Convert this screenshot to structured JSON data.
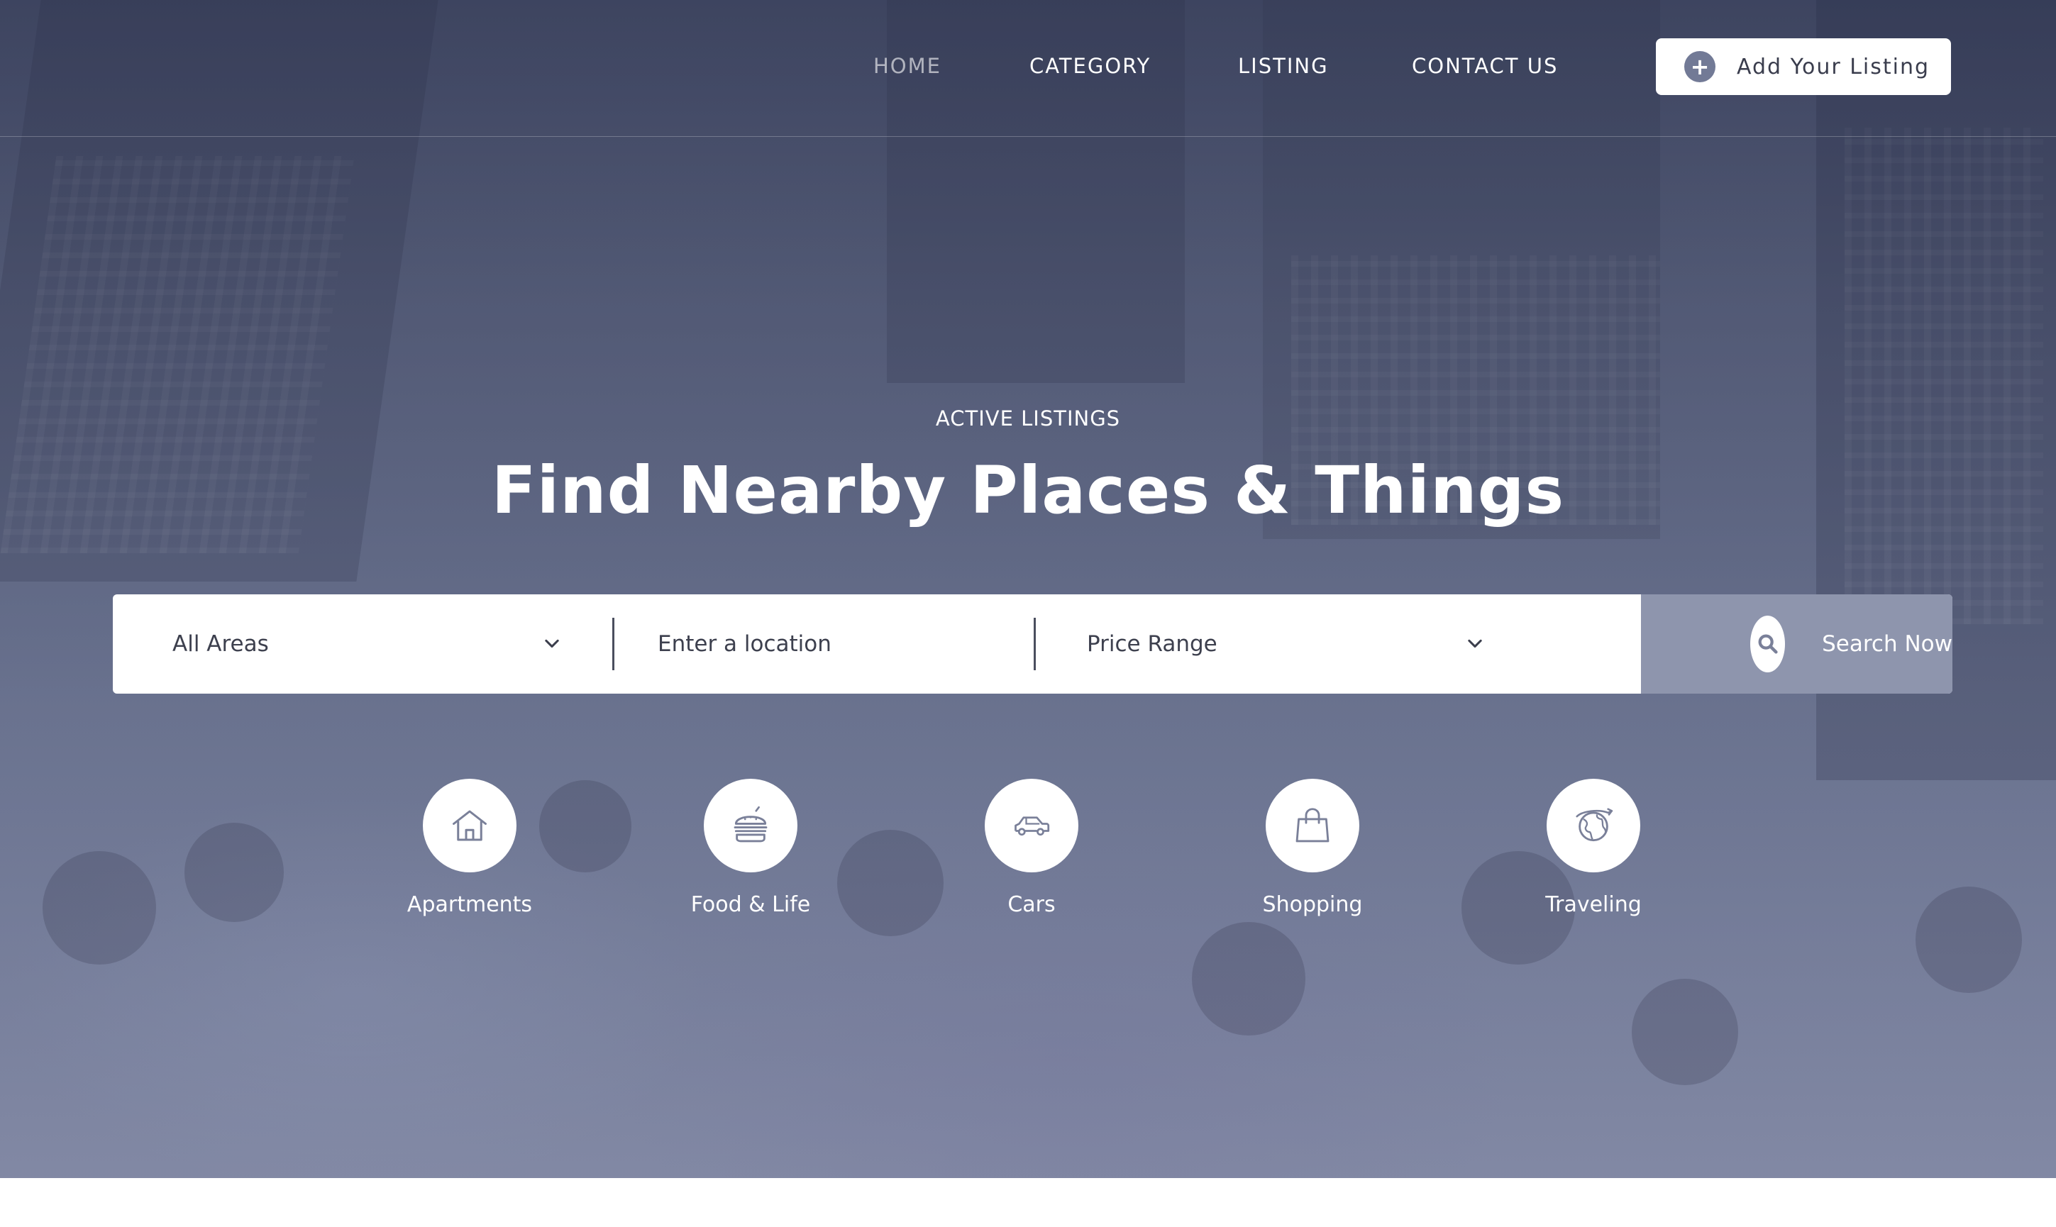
{
  "nav": {
    "links": [
      {
        "label": "HOME",
        "active": true
      },
      {
        "label": "CATEGORY",
        "active": false
      },
      {
        "label": "LISTING",
        "active": false
      },
      {
        "label": "CONTACT US",
        "active": false
      }
    ],
    "add_listing": {
      "icon": "plus-icon",
      "label": "Add Your Listing"
    }
  },
  "hero": {
    "eyebrow": "ACTIVE LISTINGS",
    "title": "Find Nearby Places & Things"
  },
  "search": {
    "areas": {
      "selected": "All Areas",
      "icon": "chevron-down-icon"
    },
    "location": {
      "placeholder": "Enter a location"
    },
    "price": {
      "selected": "Price Range",
      "icon": "chevron-down-icon"
    },
    "button": {
      "icon": "search-icon",
      "label": "Search Now"
    }
  },
  "categories": [
    {
      "label": "Apartments",
      "icon": "house-icon"
    },
    {
      "label": "Food & Life",
      "icon": "burger-icon"
    },
    {
      "label": "Cars",
      "icon": "car-icon"
    },
    {
      "label": "Shopping",
      "icon": "shopping-bag-icon"
    },
    {
      "label": "Traveling",
      "icon": "globe-icon"
    }
  ],
  "colors": {
    "accent": "#8e95ad",
    "icon_stroke": "#7a8099",
    "overlay": "#4d5570",
    "text": "#ffffff"
  }
}
